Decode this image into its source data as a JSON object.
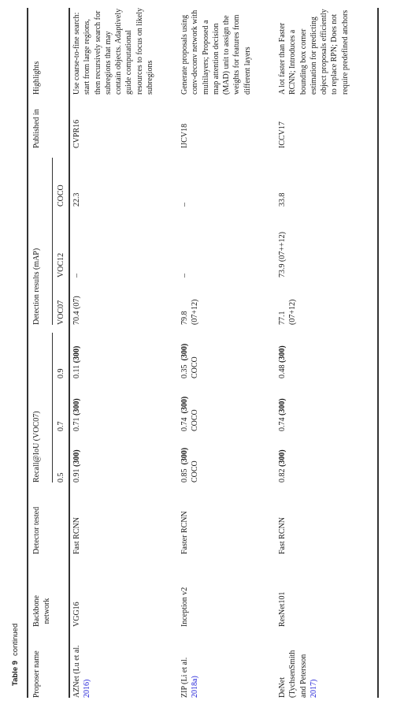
{
  "caption": {
    "label": "Table 9",
    "text": "continued"
  },
  "headers": {
    "proposer": "Proposer name",
    "backbone": [
      "Backbone",
      "network"
    ],
    "detector": "Detector tested",
    "recall": "Recall@IoU (VOC07)",
    "recall_sub": [
      "0.5",
      "0.7",
      "0.9"
    ],
    "detection": "Detection results (mAP)",
    "detection_sub": [
      "VOC07",
      "VOC12",
      "COCO"
    ],
    "published": "Published in",
    "highlights": "Highlights"
  },
  "rows": [
    {
      "name": "AZNet (Lu et al.",
      "ref": "2016)",
      "backbone": "VGG16",
      "detector": "Fast RCNN",
      "recall": [
        {
          "v": "0.91",
          "n": "(300)",
          "ds": ""
        },
        {
          "v": "0.71",
          "n": "(300)",
          "ds": ""
        },
        {
          "v": "0.11",
          "n": "(300)",
          "ds": ""
        }
      ],
      "voc07": [
        "70.4 (07)",
        ""
      ],
      "voc12": "–",
      "coco": "22.3",
      "published": "CVPR16",
      "highlights": "Use coarse-to-fine search: start from large regions, then recursively search for subregions that may contain objects. Adaptively guide computational resources to focus on likely subregions"
    },
    {
      "name": "ZIP (Li et al.",
      "ref": "2018a)",
      "backbone": "Inception v2",
      "detector": "Faster RCNN",
      "recall": [
        {
          "v": "0.85",
          "n": "(300)",
          "ds": "COCO"
        },
        {
          "v": "0.74",
          "n": "(300)",
          "ds": "COCO"
        },
        {
          "v": "0.35",
          "n": "(300)",
          "ds": "COCO"
        }
      ],
      "voc07": [
        "79.8",
        "(07+12)"
      ],
      "voc12": "–",
      "coco": "–",
      "published": "IJCV18",
      "highlights": "Generate proposals using conv-deconv network with multilayers; Proposed a map attention decision (MAD) unit to assign the weights for features from different layers"
    },
    {
      "name": "DeNet (TychsenSmith and Petersson",
      "ref": "2017)",
      "backbone": "ResNet101",
      "detector": "Fast RCNN",
      "recall": [
        {
          "v": "0.82",
          "n": "(300)",
          "ds": ""
        },
        {
          "v": "0.74",
          "n": "(300)",
          "ds": ""
        },
        {
          "v": "0.48",
          "n": "(300)",
          "ds": ""
        }
      ],
      "voc07": [
        "77.1",
        "(07+12)"
      ],
      "voc12": "73.9 (07++12)",
      "coco": "33.8",
      "published": "ICCV17",
      "highlights": "A lot faster than Faster RCNN; Introduces a bounding box corner estimation for predicting object proposals efficiently to replace RPN; Does not require predefined anchors"
    }
  ]
}
